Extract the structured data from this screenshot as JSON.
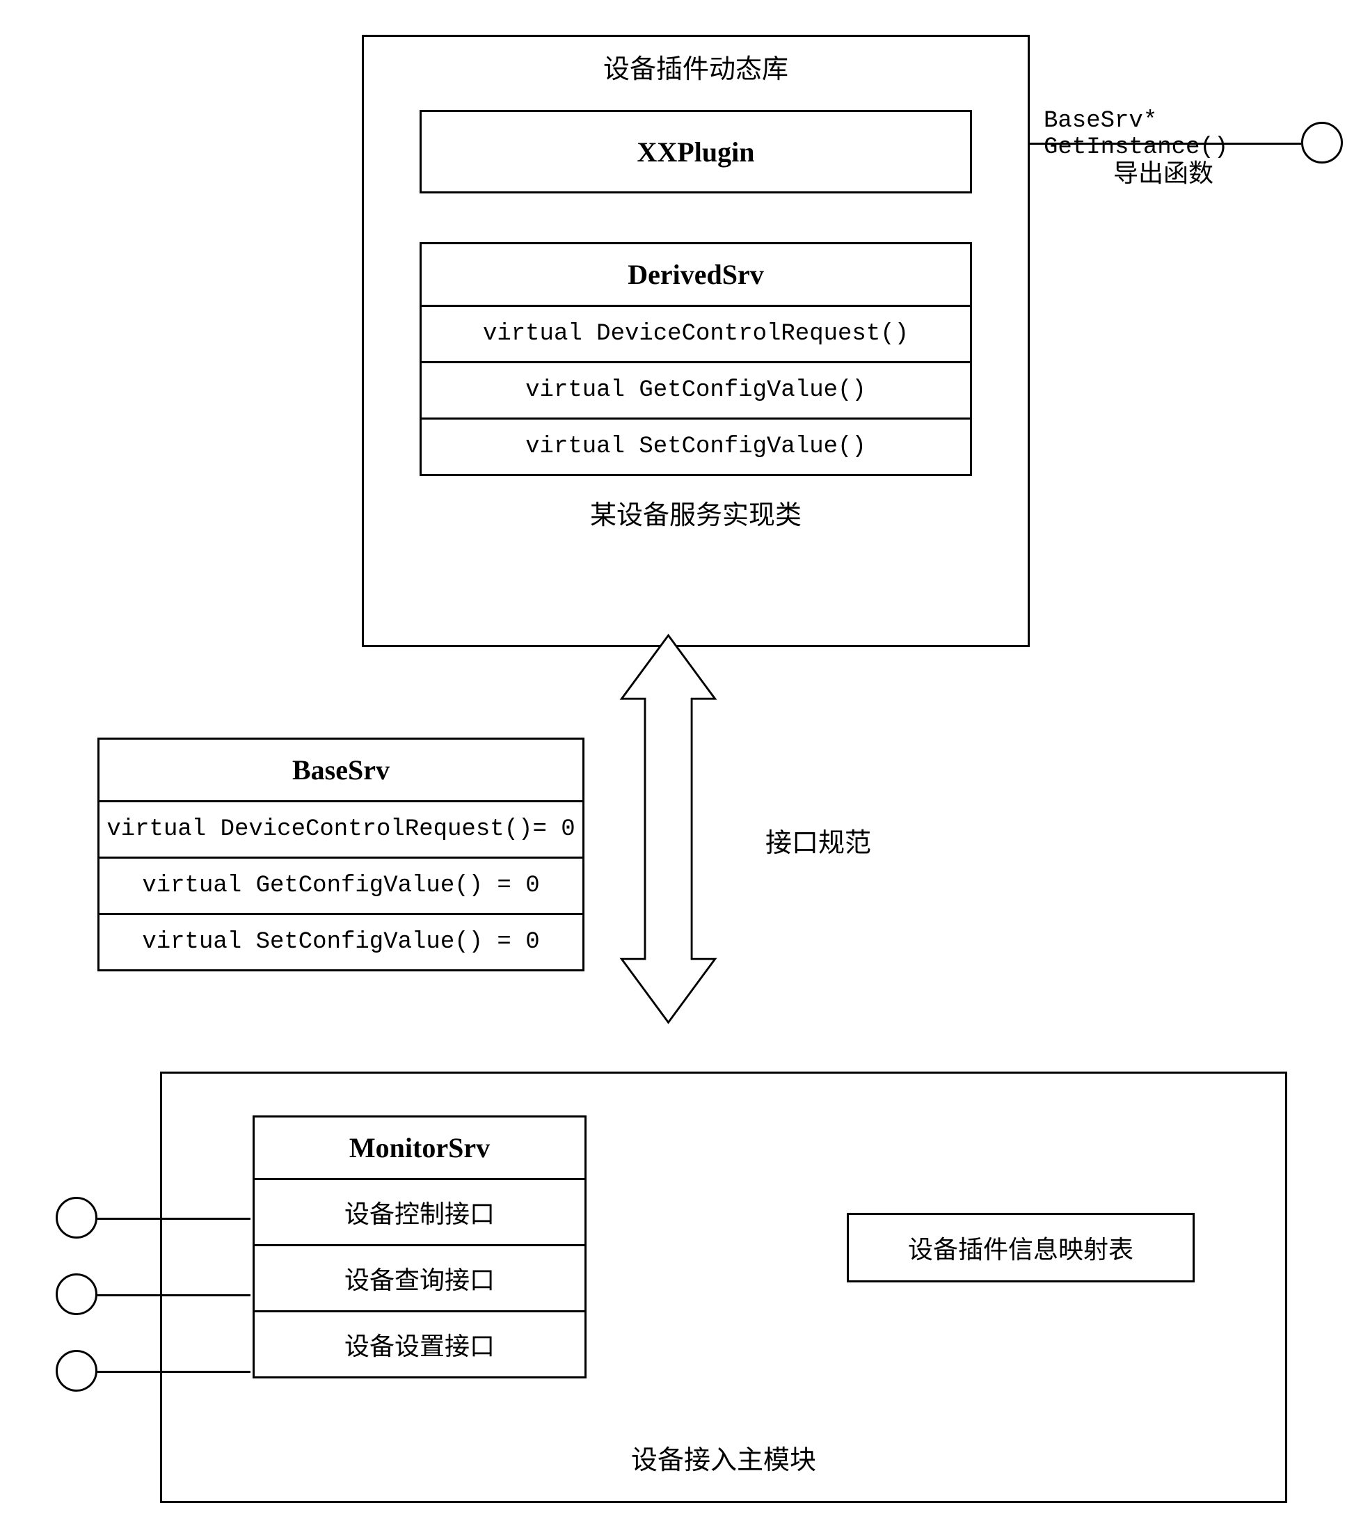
{
  "top_module": {
    "title": "设备插件动态库",
    "plugin_box": "XXPlugin",
    "derived_class": {
      "name": "DerivedSrv",
      "methods": [
        "virtual DeviceControlRequest()",
        "virtual GetConfigValue()",
        "virtual SetConfigValue()"
      ],
      "caption": "某设备服务实现类"
    },
    "export_signature": "BaseSrv* GetInstance()",
    "export_label": "导出函数"
  },
  "base_class": {
    "name": "BaseSrv",
    "methods": [
      "virtual DeviceControlRequest()= 0",
      "virtual GetConfigValue() = 0",
      "virtual SetConfigValue() = 0"
    ]
  },
  "middle_label": "接口规范",
  "bottom_module": {
    "title": "设备接入主模块",
    "monitor_class": {
      "name": "MonitorSrv",
      "interfaces": [
        "设备控制接口",
        "设备查询接口",
        "设备设置接口"
      ]
    },
    "mapping_box": "设备插件信息映射表"
  }
}
